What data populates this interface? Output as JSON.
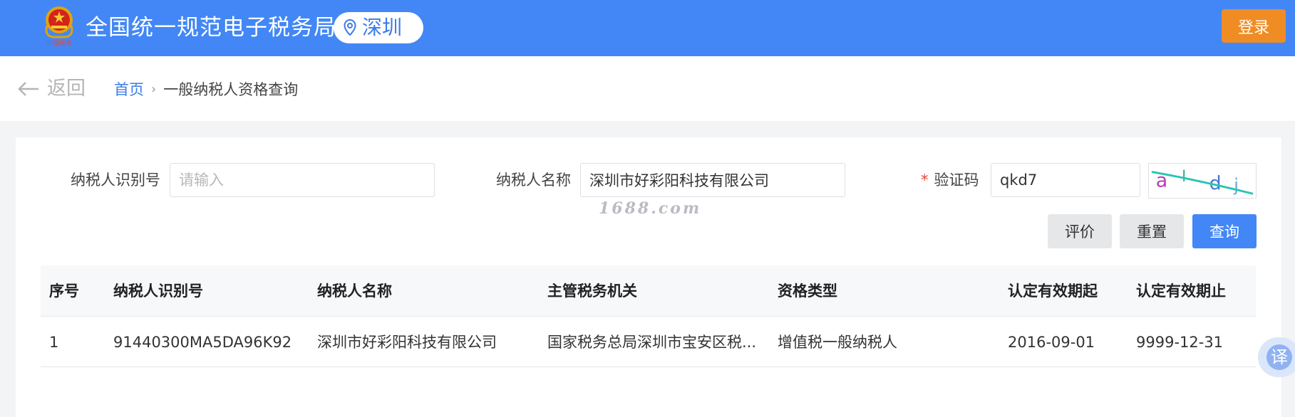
{
  "header": {
    "site_title": "全国统一规范电子税务局",
    "city": "深圳",
    "login_label": "登录"
  },
  "nav": {
    "back_label": "返回",
    "breadcrumb_home": "首页",
    "breadcrumb_current": "一般纳税人资格查询"
  },
  "form": {
    "taxpayer_id_label": "纳税人识别号",
    "taxpayer_id_placeholder": "请输入",
    "taxpayer_id_value": "",
    "taxpayer_name_label": "纳税人名称",
    "taxpayer_name_value": "深圳市好彩阳科技有限公司",
    "captcha_label": "验证码",
    "captcha_required_mark": "*",
    "captcha_value": "qkd7",
    "captcha_image_text": "a l d j"
  },
  "watermark": "1688.com",
  "buttons": {
    "evaluate": "评价",
    "reset": "重置",
    "query": "查询"
  },
  "table": {
    "columns": [
      "序号",
      "纳税人识别号",
      "纳税人名称",
      "主管税务机关",
      "资格类型",
      "认定有效期起",
      "认定有效期止"
    ],
    "rows": [
      [
        "1",
        "91440300MA5DA96K92",
        "深圳市好彩阳科技有限公司",
        "国家税务总局深圳市宝安区税...",
        "增值税一般纳税人",
        "2016-09-01",
        "9999-12-31"
      ]
    ]
  },
  "translate_button": "译",
  "colors": {
    "header_bg": "#4287f5",
    "login_bg": "#f08c24",
    "link": "#3b7be8",
    "required": "#e8453c"
  }
}
